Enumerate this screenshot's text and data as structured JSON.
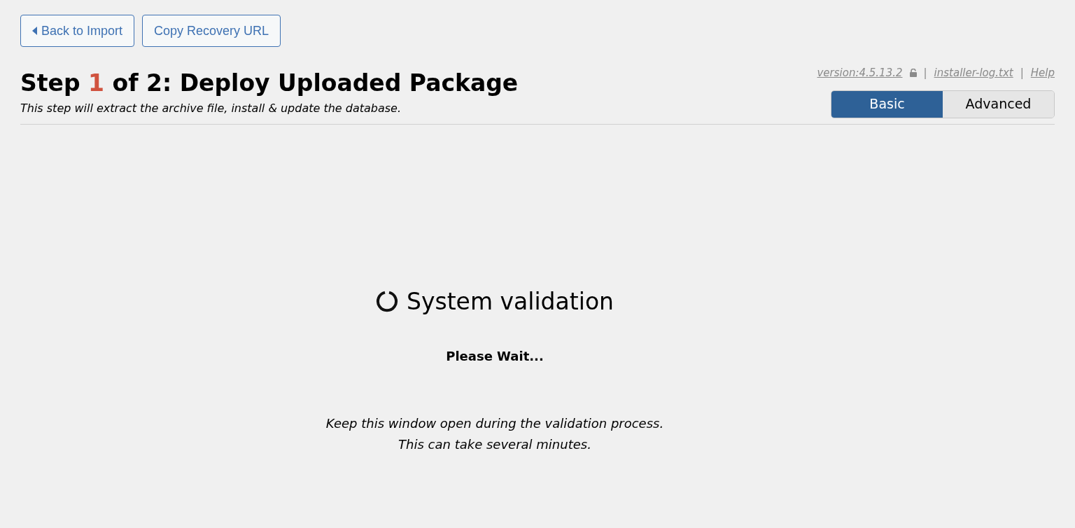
{
  "toolbar": {
    "buttons": [
      {
        "label": "Back to Import",
        "kind": "back"
      },
      {
        "label": "Copy Recovery URL",
        "kind": "plain"
      }
    ]
  },
  "header": {
    "title": {
      "prefix": "Step",
      "step": "1",
      "suffix": "of 2: Deploy Uploaded Package"
    },
    "subtitle": "This step will extract the archive file, install & update the database.",
    "links": [
      {
        "label": "version:4.5.13.2",
        "kind": "version"
      },
      {
        "label": "installer-log.txt",
        "kind": "link"
      },
      {
        "label": "Help",
        "kind": "link"
      }
    ],
    "separators": [
      "|",
      "|"
    ],
    "mode_tabs": [
      {
        "label": "Basic",
        "selected": true
      },
      {
        "label": "Advanced",
        "selected": false
      }
    ]
  },
  "progress": {
    "title": "System validation",
    "status": "Please Wait...",
    "notes": [
      "Keep this window open during the validation process.",
      "This can take several minutes."
    ]
  }
}
